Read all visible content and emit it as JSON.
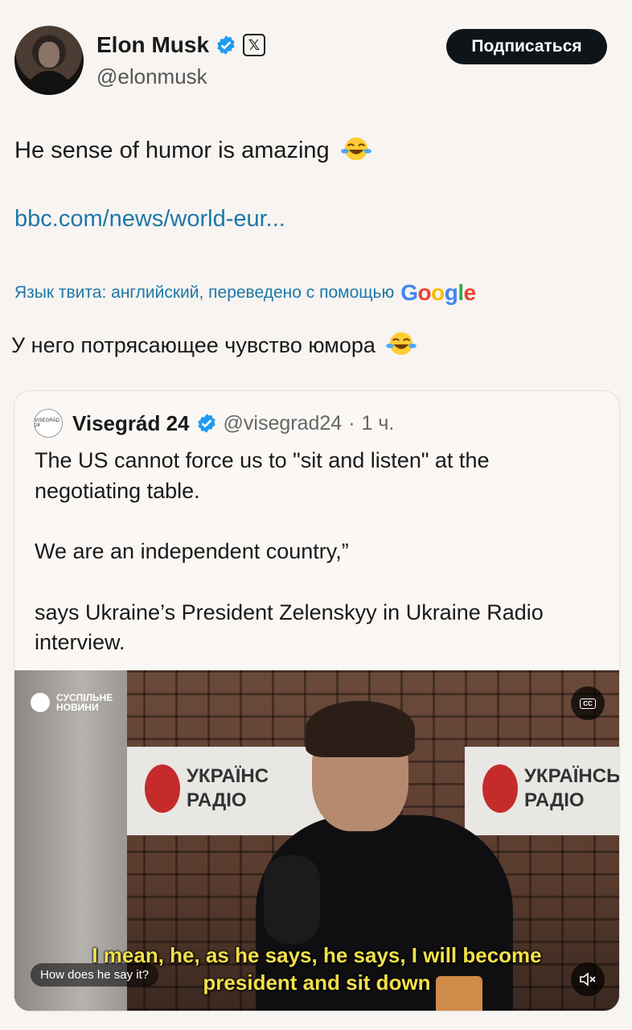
{
  "author": {
    "name": "Elon Musk",
    "handle": "@elonmusk",
    "avatar_icon": "avatar-photo",
    "verified_icon": "verified-badge-icon",
    "affiliation_icon": "x-logo-icon"
  },
  "follow_button": {
    "label": "Подписаться"
  },
  "tweet": {
    "text": "He sense of humor is amazing",
    "emoji_icon": "laughing-tears-emoji",
    "link": "bbc.com/news/world-eur..."
  },
  "translation": {
    "note": "Язык твита: английский, переведено с помощью",
    "provider": "Google",
    "text": "У него потрясающее чувство юмора"
  },
  "quoted": {
    "logo_text": "VISEGRÁD 24",
    "name": "Visegrád 24",
    "handle": "@visegrad24",
    "separator": "·",
    "time": "1 ч.",
    "paragraphs": [
      "The US cannot force us to \"sit and listen\" at the negotiating table.",
      "We are an independent country,”",
      "says Ukraine’s President Zelenskyy in Ukraine Radio interview."
    ],
    "video": {
      "brand": "СУСПІЛЬНЕ НОВИНИ",
      "sign_left": "УКРАЇНС РАДІО",
      "sign_right": "УКРАЇНСЬКЕ РАДІО",
      "caption_line1": "I mean, he, as he says, he says, I will become",
      "caption_line2": "president and sit down",
      "hint": "How does he say it?",
      "cc_label": "CC",
      "mute_icon": "speaker-muted-icon"
    }
  },
  "colors": {
    "background": "#f7f4f1",
    "link": "#1d78a8",
    "verified": "#1d9bf0",
    "caption": "#f3e04a"
  }
}
